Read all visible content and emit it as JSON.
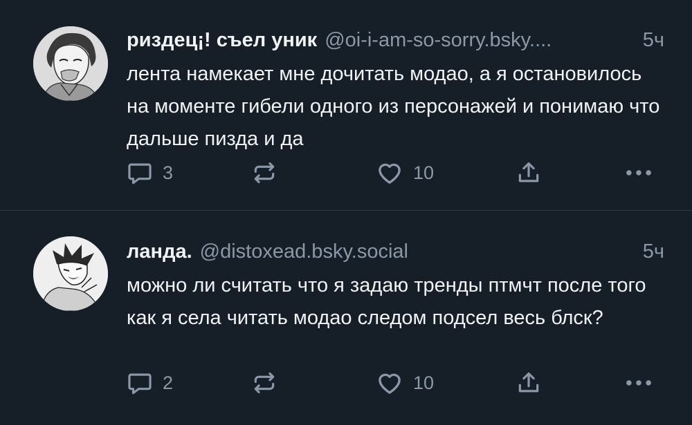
{
  "posts": [
    {
      "display_name": "риздец¡! съел уник",
      "handle": "@oi-i-am-so-sorry.bsky....",
      "time": "5ч",
      "text": "лента намекает мне дочитать модао, а я остановилось на моменте гибели одного из персонажей и понимаю что дальше пизда и да",
      "reply_count": "3",
      "like_count": "10",
      "avatar": "drawn-man-portrait"
    },
    {
      "display_name": "ланда.",
      "handle": "@distoxead.bsky.social",
      "time": "5ч",
      "text": "можно ли считать что я задаю тренды птмчт после того как я села читать модао следом подсел весь блск?",
      "reply_count": "2",
      "like_count": "10",
      "avatar": "manga-boy-shouting"
    }
  ],
  "icons": {
    "reply": "speech-bubble-icon",
    "repost": "repost-arrows-icon",
    "like": "heart-icon",
    "share": "share-icon",
    "more": "more-dots-icon"
  },
  "colors": {
    "background": "#161e27",
    "text": "#f1f3f5",
    "muted": "#8a98a9",
    "divider": "#2e3a48"
  }
}
